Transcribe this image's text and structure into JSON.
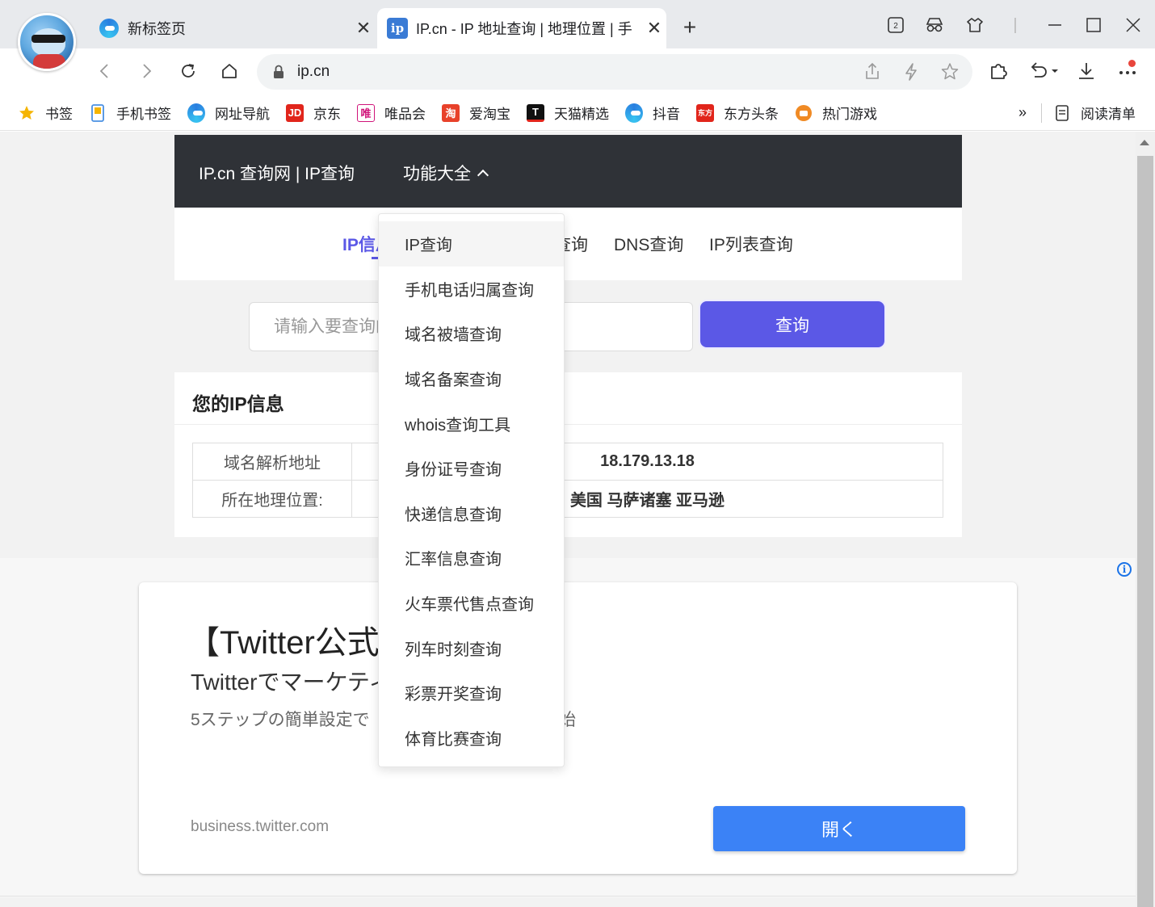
{
  "tabs": [
    {
      "title": "新标签页",
      "active": false,
      "favicon": "edge-icon"
    },
    {
      "title": "IP.cn - IP 地址查询 | 地理位置 | 手",
      "active": true,
      "favicon": "ip-icon"
    }
  ],
  "window": {
    "tab_count": "2"
  },
  "address_bar": {
    "url": "ip.cn"
  },
  "bookmarks": [
    {
      "label": "书签",
      "icon": "star-icon"
    },
    {
      "label": "手机书签",
      "icon": "phone-icon"
    },
    {
      "label": "网址导航",
      "icon": "edge-icon"
    },
    {
      "label": "京东",
      "icon": "jd-icon",
      "icon_text": "JD"
    },
    {
      "label": "唯品会",
      "icon": "vip-icon",
      "icon_text": "唯"
    },
    {
      "label": "爱淘宝",
      "icon": "taobao-icon",
      "icon_text": "淘"
    },
    {
      "label": "天猫精选",
      "icon": "tmall-icon",
      "icon_text": "T"
    },
    {
      "label": "抖音",
      "icon": "edge-icon"
    },
    {
      "label": "东方头条",
      "icon": "dongfang-icon",
      "icon_text": "东方"
    },
    {
      "label": "热门游戏",
      "icon": "game-icon"
    }
  ],
  "bookmarks_more": "»",
  "reading_list": "阅读清单",
  "site": {
    "brand": "IP.cn 查询网 | IP查询",
    "menu_label": "功能大全",
    "subtabs": [
      "IP信息",
      "查询",
      "DNS查询",
      "IP列表查询"
    ],
    "search_placeholder": "请输入要查询的IP或域名",
    "search_button": "查询",
    "card_title": "您的IP信息",
    "info_rows": [
      {
        "key": "域名解析地址",
        "value": "18.179.13.18"
      },
      {
        "key": "所在地理位置:",
        "value": "美国 马萨诸塞 亚马逊"
      }
    ],
    "dropdown": [
      "IP查询",
      "手机电话归属查询",
      "域名被墙查询",
      "域名备案查询",
      "whois查询工具",
      "身份证号查询",
      "快递信息查询",
      "汇率信息查询",
      "火车票代售点查询",
      "列车时刻查询",
      "彩票开奖查询",
      "体育比赛查询"
    ]
  },
  "ad": {
    "title": "【Twitter公式",
    "subtitle": "Twitterでマーケティ",
    "description": "5ステップの簡単設定で",
    "description_tail": "始",
    "domain": "business.twitter.com",
    "button": "開く"
  },
  "colors": {
    "accent": "#5b58e6",
    "nav_bg": "#2f3237",
    "ad_button": "#3b82f6"
  }
}
